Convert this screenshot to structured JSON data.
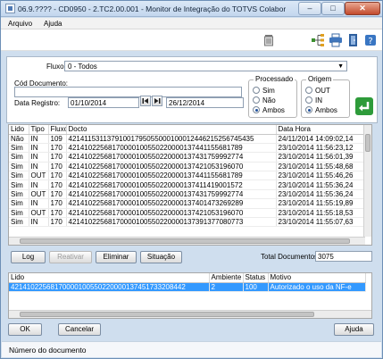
{
  "window": {
    "title": "06.9.???? - CD0950 - 2.TC2.00.001 - Monitor de Integração do TOTVS Colaboraç",
    "minimize": "–",
    "maximize": "□",
    "close": "✕"
  },
  "menu": {
    "items": [
      {
        "label": "Arquivo"
      },
      {
        "label": "Ajuda"
      }
    ]
  },
  "filters": {
    "fluxo_label": "Fluxo:",
    "fluxo_value": "0   - Todos",
    "cod_label": "Cód Documento:",
    "cod_value": "",
    "data_label": "Data Registro:",
    "data_inicio": "01/10/2014",
    "data_fim": "26/12/2014",
    "processado": {
      "title": "Processado",
      "options": [
        "Sim",
        "Não",
        "Ambos"
      ],
      "selected": "Ambos"
    },
    "origem": {
      "title": "Origem",
      "options": [
        "OUT",
        "IN",
        "Ambos"
      ],
      "selected": "Ambos"
    }
  },
  "grid": {
    "columns": [
      "Lido",
      "Tipo",
      "Fluxo",
      "Docto",
      "Data Hora"
    ],
    "rows": [
      [
        "Não",
        "IN",
        "109",
        "42141153113791001795055000100012446215256745435",
        "24/11/2014 14:09:02,14"
      ],
      [
        "Sim",
        "IN",
        "170",
        "42141022568170000100550220000137441155681789",
        "23/10/2014 11:56:23,12"
      ],
      [
        "Sim",
        "IN",
        "170",
        "42141022568170000100550220000137431759992774",
        "23/10/2014 11:56:01,39"
      ],
      [
        "Sim",
        "IN",
        "170",
        "42141022568170000100550220000137421053196070",
        "23/10/2014 11:55:48,68"
      ],
      [
        "Sim",
        "OUT",
        "170",
        "42141022568170000100550220000137441155681789",
        "23/10/2014 11:55:46,26"
      ],
      [
        "Sim",
        "IN",
        "170",
        "42141022568170000100550220000137411419001572",
        "23/10/2014 11:55:36,24"
      ],
      [
        "Sim",
        "OUT",
        "170",
        "42141022568170000100550220000137431759992774",
        "23/10/2014 11:55:36,24"
      ],
      [
        "Sim",
        "IN",
        "170",
        "42141022568170000100550220000137401473269289",
        "23/10/2014 11:55:19,89"
      ],
      [
        "Sim",
        "OUT",
        "170",
        "42141022568170000100550220000137421053196070",
        "23/10/2014 11:55:18,53"
      ],
      [
        "Sim",
        "IN",
        "170",
        "42141022568170000100550220000137391377080773",
        "23/10/2014 11:55:07,63"
      ]
    ]
  },
  "actions": {
    "log": "Log",
    "reativar": "Reativar",
    "eliminar": "Eliminar",
    "situacao": "Situação",
    "total_label": "Total Documentos:",
    "total_value": "3075"
  },
  "detail": {
    "columns": [
      "Lido",
      "Ambiente",
      "Status",
      "Motivo"
    ],
    "rows": [
      [
        "42141022568170000100550220000137451733208442",
        "2",
        "100",
        "Autorizado o uso da NF-e"
      ]
    ]
  },
  "footer": {
    "ok": "OK",
    "cancelar": "Cancelar",
    "ajuda": "Ajuda"
  },
  "status": {
    "text": "Número do documento"
  },
  "colors": {
    "selection": "#3399ff",
    "accent_green": "#2e9b3a",
    "window_frame": "#cfdeee"
  }
}
